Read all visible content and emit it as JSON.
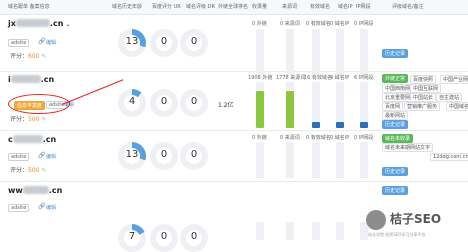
{
  "header": {
    "cols": [
      "域名跟单 备案信息",
      "域名历史年龄",
      "百度评分 UR",
      "域名评级 DR",
      "外链全球排名",
      "收录量",
      "来源词",
      "有效域名",
      "域名IP",
      "IP网段",
      "评级域名/备注"
    ]
  },
  "rows": [
    {
      "domain_prefix": "jx",
      "domain_suffix": ".cn",
      "tag": "adsite",
      "edit_label": "编辑",
      "score_label": "评分：",
      "score_value": "600",
      "age": "13",
      "ur": "0",
      "dr": "0",
      "rank": "",
      "bars": [
        {
          "label": "0 外链",
          "fill": 0.0
        },
        {
          "label": "0 来源词",
          "fill": 0.0
        },
        {
          "label": "0 有效域名",
          "fill": 0.0
        },
        {
          "label": "0 域名IP",
          "fill": 0.0
        },
        {
          "label": "0 IP网段",
          "fill": 0.0
        }
      ],
      "history_btn": "历史记录"
    },
    {
      "domain_prefix": "i",
      "domain_suffix": ".cn",
      "tag": "adsite",
      "orange_tag": "信息丰富度",
      "edit_label": "编辑",
      "score_label": "评分：",
      "score_value": "500",
      "age": "4",
      "ur": "0",
      "dr": "0",
      "rank": "1.2亿",
      "bars": [
        {
          "label": "1908 外链",
          "fill": 0.8
        },
        {
          "label": "1778 来源词",
          "fill": 0.8
        },
        {
          "label": "16 有效域名",
          "fill": 0.12
        },
        {
          "label": "4 域名IP",
          "fill": 0.12
        },
        {
          "label": "6 IP网段",
          "fill": 0.12
        }
      ],
      "green_btn": "外链正常",
      "chips": [
        "百度快照",
        "中国产业网",
        "中国西南网",
        "中国互联网",
        "北京重要网",
        "中国站长",
        "自主建站",
        "百度网",
        "营销推广服务",
        "中国域名",
        "最新网站"
      ],
      "history_btn": "历史记录"
    },
    {
      "domain_prefix": "c",
      "domain_suffix": ".cn",
      "tag": "adsite",
      "edit_label": "编辑",
      "score_label": "评分：",
      "score_value": "500",
      "age": "13",
      "ur": "0",
      "dr": "0",
      "rank": "",
      "bars": [
        {
          "label": "0 外链",
          "fill": 0.0
        },
        {
          "label": "0 来源词",
          "fill": 0.0
        },
        {
          "label": "0 有效域名",
          "fill": 0.0
        },
        {
          "label": "0 域名IP",
          "fill": 0.0
        },
        {
          "label": "0 IP网段",
          "fill": 0.0
        }
      ],
      "green_btn": "域名未收录",
      "chips": [
        "域名未来期网站文字",
        "12ddg.com.cn"
      ],
      "history_btn": "历史记录"
    },
    {
      "domain_prefix": "ww",
      "domain_suffix": ".cn",
      "tag": "adsite",
      "edit_label": "编辑",
      "age": "7",
      "ur": "0",
      "dr": "0",
      "rank": "",
      "bars": [
        {
          "label": "",
          "fill": 0.0
        },
        {
          "label": "",
          "fill": 0.0
        },
        {
          "label": "",
          "fill": 0.0
        },
        {
          "label": "",
          "fill": 0.0
        },
        {
          "label": "",
          "fill": 0.0
        }
      ],
      "history_btn": "历史记录"
    }
  ],
  "watermark": {
    "title": "桔子SEO",
    "subtitle": "站长学院·优质SEO学习分享平台"
  },
  "colors": {
    "accent_blue": "#5aa0e0",
    "green": "#58b85a",
    "orange": "#f08a24",
    "annotation_red": "#e2261d"
  }
}
